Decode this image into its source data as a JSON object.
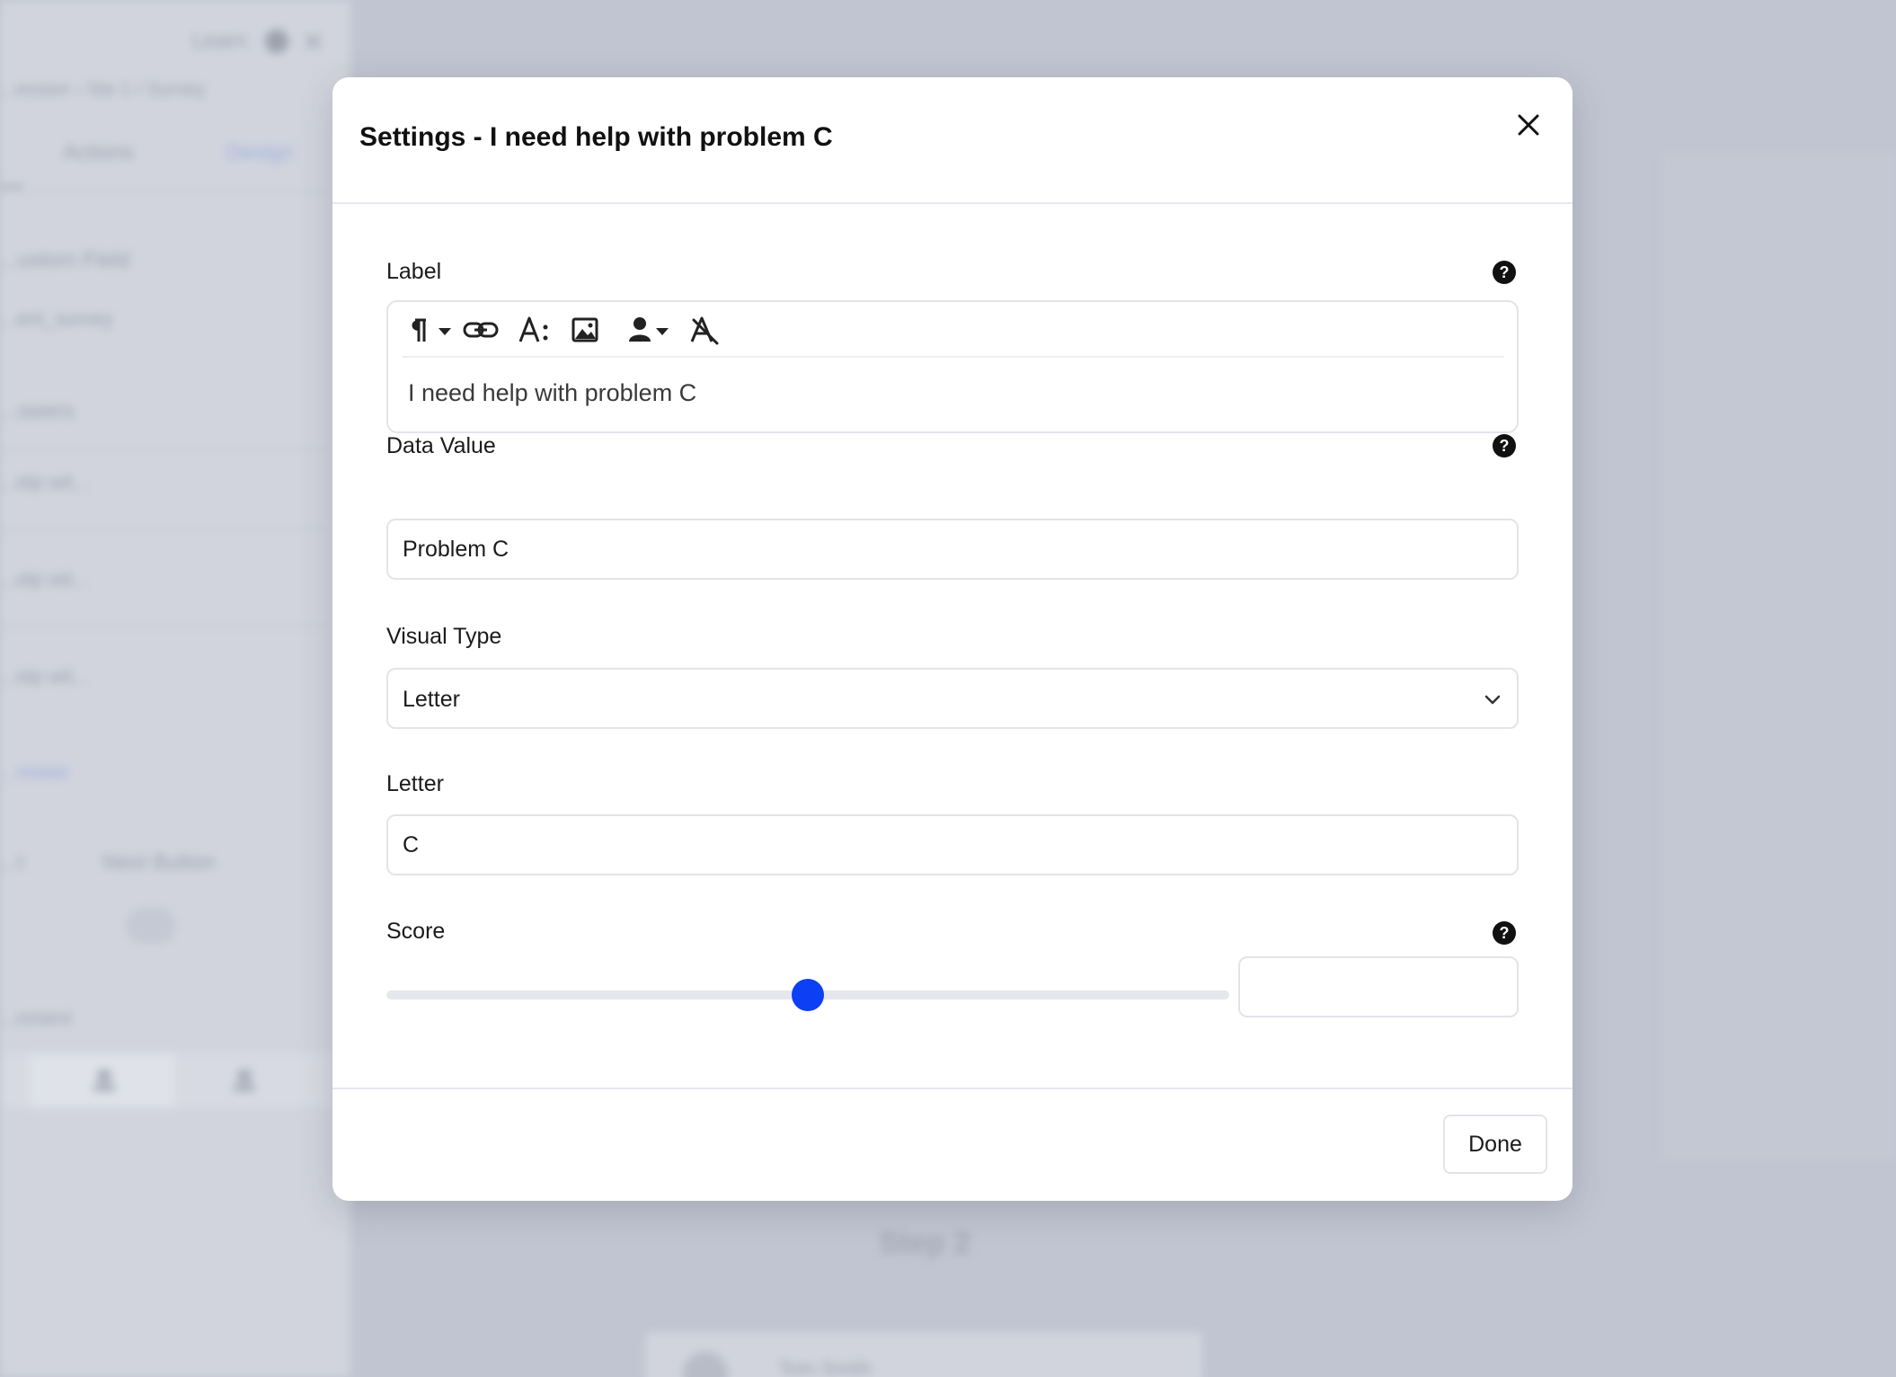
{
  "background": {
    "header_learn": "Learn",
    "breadcrumb": "...ession  ›  Ste 1  /  Survey",
    "tab_actions": "Actions",
    "tab_design": "Design",
    "custom_field_label": "...ustom Field",
    "custom_field_value": "...ent_survey",
    "answers_label": "...swers",
    "answer_items": [
      "...elp wit...",
      "...elp wit...",
      "...elp wit..."
    ],
    "add_answer": "...nswer",
    "next_button_label": "Next Button",
    "short_label": "...t",
    "alignment_label": "...nment",
    "step_heading": "Step 2",
    "bottom_card_name": "Tom Smith"
  },
  "modal": {
    "title": "Settings - I need help with problem C",
    "fields": {
      "label": {
        "label": "Label",
        "content": "I need help with problem C"
      },
      "data_value": {
        "label": "Data Value",
        "value": "Problem C"
      },
      "visual_type": {
        "label": "Visual Type",
        "selected": "Letter"
      },
      "letter": {
        "label": "Letter",
        "value": "C"
      },
      "score": {
        "label": "Score",
        "slider_fraction": 0.5,
        "value": ""
      }
    },
    "done_label": "Done"
  },
  "colors": {
    "accent": "#0d3ff5",
    "backdrop": "#c1c5d1",
    "border": "#e2e4ea"
  },
  "icons": {
    "close": "close-icon",
    "help": "help-circle-icon",
    "toolbar": [
      "paragraph-icon",
      "link-icon",
      "font-size-icon",
      "image-icon",
      "user-variable-icon",
      "clear-format-icon"
    ],
    "chevron": "chevron-down-icon"
  }
}
